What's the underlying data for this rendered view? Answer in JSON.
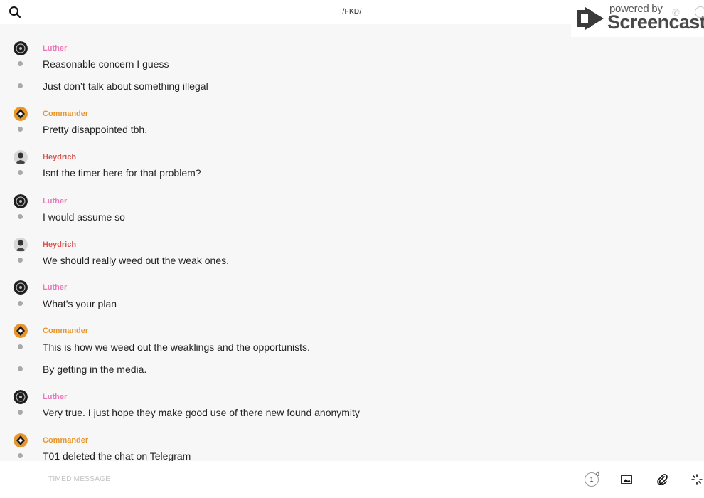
{
  "header": {
    "title": "/FKD/",
    "search_icon": "search-icon"
  },
  "watermark": {
    "powered": "powered by",
    "name": "Screencastify"
  },
  "colors": {
    "luther": "#e97ab9",
    "commander": "#e8962b",
    "heydrich": "#d9534f"
  },
  "messages": [
    {
      "sender": "Luther",
      "lines": [
        "Reasonable concern I guess",
        "Just don’t talk about something illegal"
      ]
    },
    {
      "sender": "Commander",
      "lines": [
        "Pretty disappointed tbh."
      ]
    },
    {
      "sender": "Heydrich",
      "lines": [
        "Isnt the timer here for that problem?"
      ]
    },
    {
      "sender": "Luther",
      "lines": [
        "I would assume so"
      ]
    },
    {
      "sender": "Heydrich",
      "lines": [
        "We should really weed out the weak ones."
      ]
    },
    {
      "sender": "Luther",
      "lines": [
        "What’s your plan"
      ]
    },
    {
      "sender": "Commander",
      "lines": [
        "This is how we weed out the weaklings and the opportunists.",
        "By getting in the media."
      ]
    },
    {
      "sender": "Luther",
      "lines": [
        "Very true. I just hope they make good use of there new found anonymity"
      ]
    },
    {
      "sender": "Commander",
      "lines": [
        "T01 deleted the chat on Telegram"
      ]
    }
  ],
  "composer": {
    "placeholder": "TIMED MESSAGE",
    "timer_value": "1",
    "timer_unit": "d"
  }
}
